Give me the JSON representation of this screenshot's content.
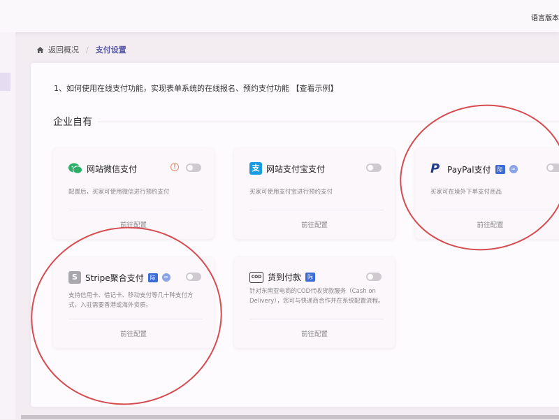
{
  "topbar": {
    "lang_label": "语言版本"
  },
  "breadcrumb": {
    "back_label": "返回概况",
    "separator": "/",
    "current": "支付设置"
  },
  "hint": {
    "text": "1、如何使用在线支付功能，实现表单系统的在线报名、预约支付功能",
    "link": "【查看示例】"
  },
  "section": {
    "title": "企业自有"
  },
  "cards": [
    {
      "title": "网站微信支付",
      "desc": "配置后，买家可使用微信进行预约支付",
      "action": "前往配置",
      "icon": "wechat-icon",
      "warn": "!"
    },
    {
      "title": "网站支付宝支付",
      "desc": "买家可使用支付宝进行预约支付",
      "action": "前往配置",
      "icon": "alipay-icon",
      "icon_glyph": "支"
    },
    {
      "title": "PayPal支付",
      "desc": "买家可在境外下单支付商品",
      "action": "前往配置",
      "icon": "paypal-icon",
      "icon_glyph": "P",
      "badge": "际"
    },
    {
      "title": "Stripe聚合支付",
      "desc": "支持信用卡、借记卡、移动支付等几十种支付方式，入驻需要香港或海外资质。",
      "action": "前往配置",
      "icon": "stripe-icon",
      "icon_glyph": "S",
      "badge": "际"
    },
    {
      "title": "货到付款",
      "desc": "针对东南亚电商的COD代收货款服务（Cash on Delivery），您可与快递商合作并在系统配置流程。",
      "action": "前往配置",
      "icon": "cod-icon",
      "icon_glyph": "COD",
      "badge": "际"
    }
  ],
  "colors": {
    "accent": "#5a5aa8",
    "annotation": "#d64b50",
    "wechat": "#2aae67",
    "alipay": "#1a9ae0",
    "paypal": "#1f3d8a",
    "stripe": "#a8a8ac"
  }
}
